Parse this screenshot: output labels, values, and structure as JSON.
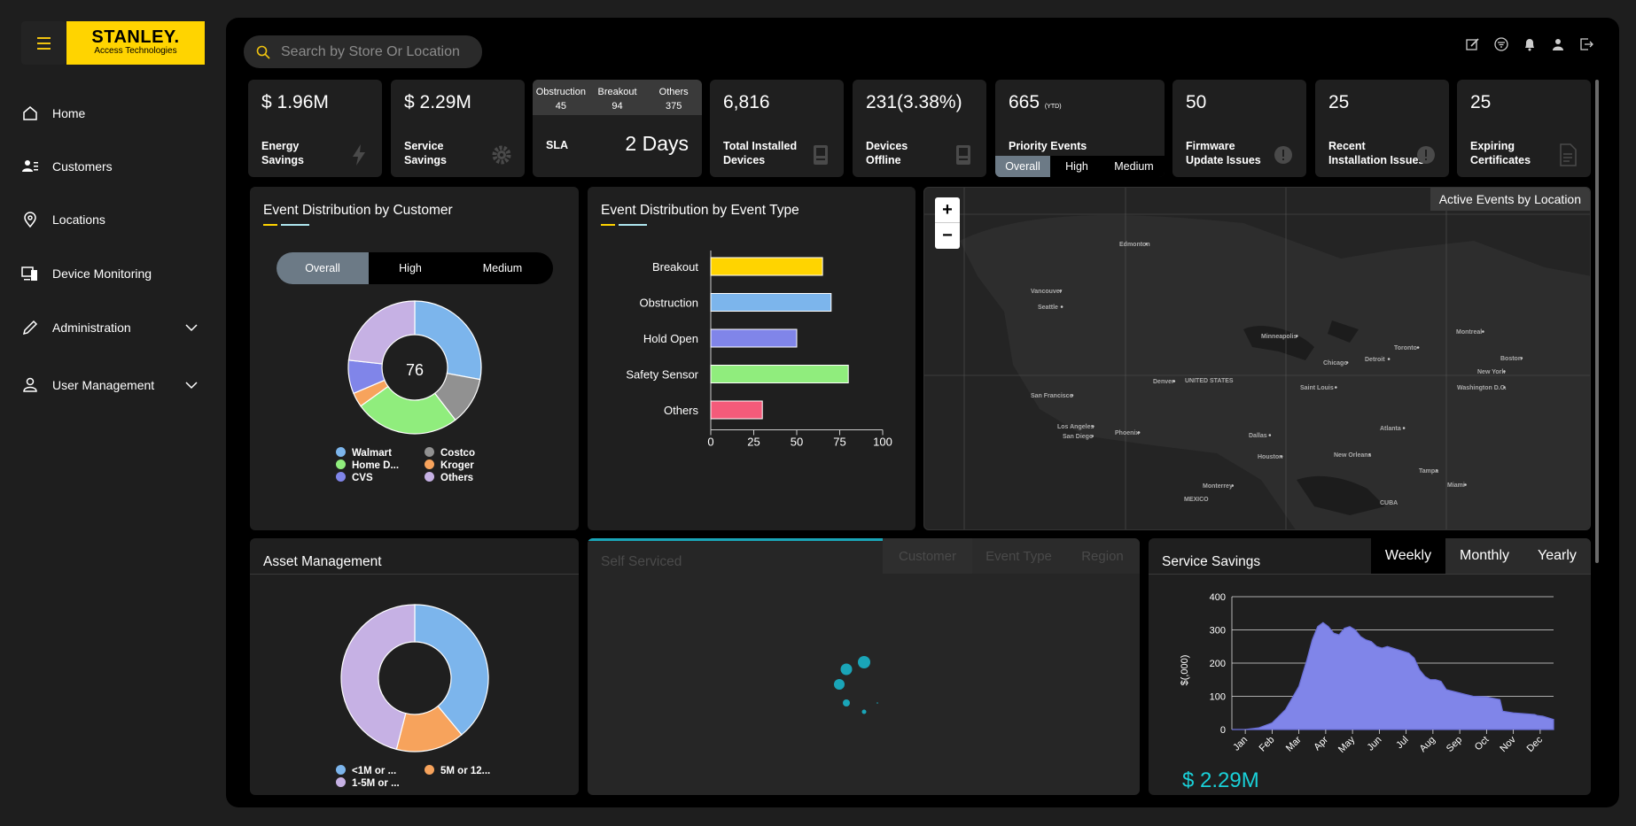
{
  "brand": {
    "name": "STANLEY.",
    "sub": "Access Technologies"
  },
  "nav": [
    {
      "label": "Home"
    },
    {
      "label": "Customers"
    },
    {
      "label": "Locations"
    },
    {
      "label": "Device Monitoring"
    },
    {
      "label": "Administration"
    },
    {
      "label": "User Management"
    }
  ],
  "search": {
    "placeholder": "Search by Store Or Location"
  },
  "kpis": {
    "energy": {
      "value": "$ 1.96M",
      "label1": "Energy",
      "label2": "Savings"
    },
    "service": {
      "value": "$ 2.29M",
      "label1": "Service",
      "label2": "Savings"
    },
    "sla": {
      "cols": [
        "Obstruction",
        "Breakout",
        "Others"
      ],
      "vals": [
        "45",
        "94",
        "375"
      ],
      "label": "SLA",
      "value": "2 Days"
    },
    "installed": {
      "value": "6,816",
      "label1": "Total Installed",
      "label2": "Devices"
    },
    "offline": {
      "value": "231(3.38%)",
      "label1": "Devices",
      "label2": "Offline"
    },
    "priority": {
      "value": "665",
      "suffix": "(YTD)",
      "label": "Priority Events",
      "tabs": [
        "Overall",
        "High",
        "Medium"
      ]
    },
    "firmware": {
      "value": "50",
      "label1": "Firmware",
      "label2": "Update Issues"
    },
    "recent": {
      "value": "25",
      "label1": "Recent",
      "label2": "Installation Issues"
    },
    "certs": {
      "value": "25",
      "label1": "Expiring",
      "label2": "Certificates"
    }
  },
  "customer_panel": {
    "title": "Event Distribution by Customer",
    "tabs": [
      "Overall",
      "High",
      "Medium"
    ],
    "center": "76",
    "legend": [
      {
        "label": "Walmart",
        "color": "#7cb5ec"
      },
      {
        "label": "Costco",
        "color": "#919191"
      },
      {
        "label": "Home D...",
        "color": "#90ed7d"
      },
      {
        "label": "Kroger",
        "color": "#f7a35c"
      },
      {
        "label": "CVS",
        "color": "#8085e9"
      },
      {
        "label": "Others",
        "color": "#c6b1e4"
      }
    ]
  },
  "type_panel": {
    "title": "Event Distribution by Event Type"
  },
  "map_panel": {
    "title": "Active Events by Location",
    "zoom_in": "+",
    "zoom_out": "−",
    "cities": [
      "Edmonton",
      "Vancouver",
      "Seattle",
      "Minneapolis",
      "Montreal",
      "Toronto",
      "Boston",
      "Chicago",
      "Detroit",
      "New York",
      "Denver",
      "UNITED STATES",
      "Saint Louis",
      "Washington D.C.",
      "San Francisco",
      "Los Angeles",
      "San Diego",
      "Phoenix",
      "Dallas",
      "Atlanta",
      "Houston",
      "New Orleans",
      "Tampa",
      "Miami",
      "Monterrey",
      "MEXICO",
      "CUBA"
    ]
  },
  "asset_panel": {
    "title": "Asset Management",
    "legend": [
      {
        "label": "<1M or ...",
        "color": "#7cb5ec"
      },
      {
        "label": "5M or 12...",
        "color": "#f7a35c"
      },
      {
        "label": "1-5M or ...",
        "color": "#c6b1e4"
      }
    ]
  },
  "self_panel": {
    "title": "Self Serviced",
    "tabs": [
      "Customer",
      "Event Type",
      "Region"
    ]
  },
  "savings_panel": {
    "title": "Service Savings",
    "tabs": [
      "Weekly",
      "Monthly",
      "Yearly"
    ],
    "total": "$ 2.29M"
  },
  "chart_data": [
    {
      "type": "pie",
      "title": "Event Distribution by Customer",
      "categories": [
        "Walmart",
        "Costco",
        "Home D...",
        "Kroger",
        "CVS",
        "Others"
      ],
      "values": [
        24,
        10,
        22,
        3,
        7,
        20
      ]
    },
    {
      "type": "bar",
      "title": "Event Distribution by Event Type",
      "categories": [
        "Breakout",
        "Obstruction",
        "Hold Open",
        "Safety Sensor",
        "Others"
      ],
      "values": [
        65,
        70,
        50,
        80,
        30
      ],
      "colors": [
        "#ffd400",
        "#7cb5ec",
        "#8085e9",
        "#90ed7d",
        "#f45b7a"
      ],
      "xticks": [
        "0",
        "25",
        "50",
        "75",
        "100"
      ],
      "xlim": [
        0,
        100
      ]
    },
    {
      "type": "pie",
      "title": "Asset Management",
      "categories": [
        "<1M or ...",
        "5M or 12...",
        "1-5M or ..."
      ],
      "values": [
        39,
        15,
        46
      ]
    },
    {
      "type": "area",
      "title": "Service Savings",
      "ylabel": "$(,000)",
      "ylim": [
        0,
        400
      ],
      "yticks": [
        "0",
        "100",
        "200",
        "300",
        "400"
      ],
      "months": [
        "Jan",
        "Feb",
        "Mar",
        "Apr",
        "May",
        "Jun",
        "Jul",
        "Aug",
        "Sep",
        "Oct",
        "Nov",
        "Dec"
      ],
      "x": [
        0,
        0.5,
        1,
        1.5,
        2,
        2.5,
        2.8,
        3,
        3.2,
        3.4,
        3.6,
        3.8,
        4,
        4.2,
        4.4,
        4.6,
        4.8,
        5,
        5.2,
        5.4,
        5.6,
        5.8,
        6,
        6.2,
        6.4,
        6.6,
        6.8,
        7,
        7.2,
        7.4,
        7.6,
        7.8,
        8,
        8.5,
        9,
        9.5,
        10,
        10.1,
        10.5,
        11,
        11.3,
        11.4,
        11.6,
        11.8,
        12
      ],
      "y": [
        0,
        0,
        5,
        20,
        60,
        130,
        210,
        270,
        310,
        322,
        310,
        290,
        285,
        305,
        310,
        300,
        280,
        270,
        265,
        250,
        245,
        250,
        245,
        240,
        235,
        230,
        215,
        180,
        160,
        150,
        150,
        145,
        120,
        110,
        100,
        98,
        90,
        55,
        50,
        47,
        45,
        42,
        40,
        35,
        30
      ]
    }
  ]
}
